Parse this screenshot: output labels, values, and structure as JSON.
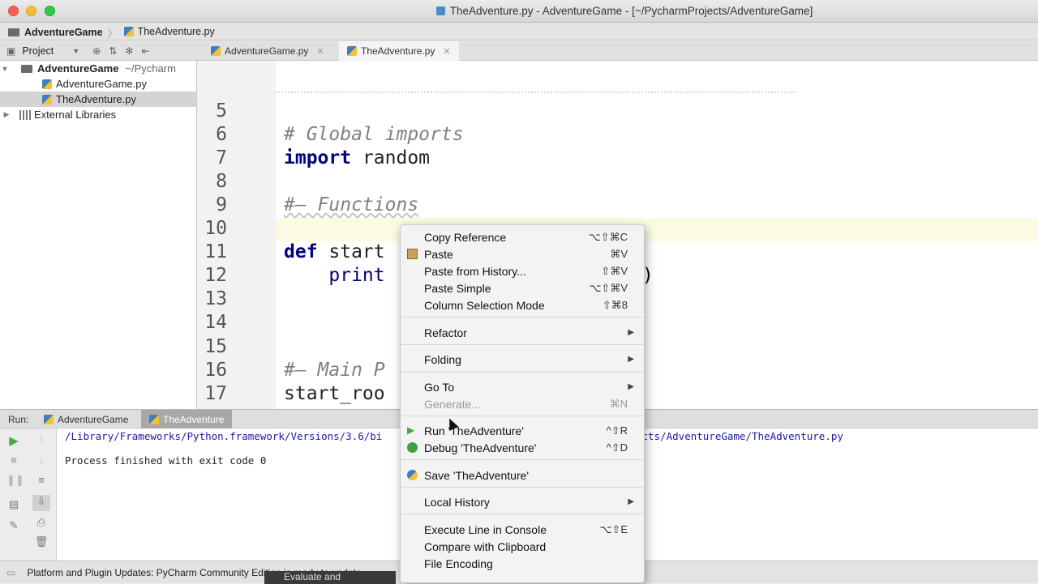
{
  "window": {
    "title": "TheAdventure.py - AdventureGame - [~/PycharmProjects/AdventureGame]"
  },
  "breadcrumb": {
    "project": "AdventureGame",
    "file": "TheAdventure.py"
  },
  "toolbar": {
    "project_label": "Project",
    "tabs": [
      {
        "label": "AdventureGame.py"
      },
      {
        "label": "TheAdventure.py"
      }
    ]
  },
  "project_tree": {
    "root": "AdventureGame",
    "root_path": "~/Pycharm",
    "files": [
      "AdventureGame.py",
      "TheAdventure.py"
    ],
    "external": "External Libraries"
  },
  "editor": {
    "lines": [
      {
        "num": "5",
        "code": ""
      },
      {
        "num": "6",
        "code": "# Global imports"
      },
      {
        "num": "7",
        "kw": "import",
        "rest": " random"
      },
      {
        "num": "8",
        "code": ""
      },
      {
        "num": "9",
        "code": "#— Functions"
      },
      {
        "num": "10",
        "code": ""
      },
      {
        "num": "11",
        "kw": "def",
        "rest": " start"
      },
      {
        "num": "12",
        "code": "    print"
      },
      {
        "num": "13",
        "code": ""
      },
      {
        "num": "14",
        "code": ""
      },
      {
        "num": "15",
        "code": ""
      },
      {
        "num": "16",
        "code": "#— Main P"
      },
      {
        "num": "17",
        "code": "start_roo"
      }
    ],
    "overflow_fragment": ")"
  },
  "run": {
    "label": "Run:",
    "tabs": [
      "AdventureGame",
      "TheAdventure"
    ],
    "console": [
      "/Library/Frameworks/Python.framework/Versions/3.6/bi",
      "Process finished with exit code 0"
    ],
    "console_tail": "ects/AdventureGame/TheAdventure.py"
  },
  "status": {
    "message": "Platform and Plugin Updates: PyCharm Community Edition is ready to update.",
    "behind": "Evaluate and"
  },
  "context_menu": {
    "items": [
      {
        "label": "Copy Reference",
        "shortcut": "⌥⇧⌘C"
      },
      {
        "label": "Paste",
        "shortcut": "⌘V",
        "icon": "paste-icon"
      },
      {
        "label": "Paste from History...",
        "shortcut": "⇧⌘V"
      },
      {
        "label": "Paste Simple",
        "shortcut": "⌥⇧⌘V"
      },
      {
        "label": "Column Selection Mode",
        "shortcut": "⇧⌘8"
      },
      {
        "label": "Refactor",
        "submenu": true
      },
      {
        "label": "Folding",
        "submenu": true
      },
      {
        "label": "Go To",
        "submenu": true
      },
      {
        "label": "Generate...",
        "shortcut": "⌘N",
        "disabled": true
      },
      {
        "label": "Run 'TheAdventure'",
        "shortcut": "^⇧R",
        "icon": "run-icon"
      },
      {
        "label": "Debug 'TheAdventure'",
        "shortcut": "^⇧D",
        "icon": "debug-icon"
      },
      {
        "label": "Save 'TheAdventure'",
        "icon": "python-icon"
      },
      {
        "label": "Local History",
        "submenu": true
      },
      {
        "label": "Execute Line in Console",
        "shortcut": "⌥⇧E"
      },
      {
        "label": "Compare with Clipboard"
      },
      {
        "label": "File Encoding"
      }
    ]
  },
  "colors": {
    "keyword": "#000080",
    "comment": "#808080",
    "run_green": "#3fae3f",
    "selected_tab": "#a8a8a8"
  }
}
